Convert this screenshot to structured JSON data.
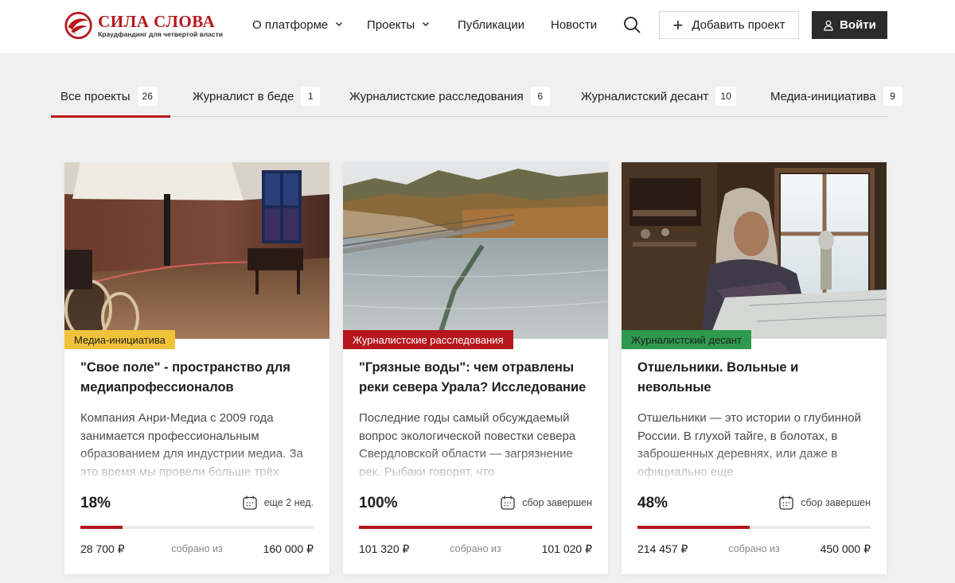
{
  "header": {
    "logo_title": "СИЛА СЛОВА",
    "logo_subtitle": "Краудфандинг для четвертой власти",
    "nav": [
      {
        "label": "О платформе",
        "has_dropdown": true
      },
      {
        "label": "Проекты",
        "has_dropdown": true
      },
      {
        "label": "Публикации",
        "has_dropdown": false
      },
      {
        "label": "Новости",
        "has_dropdown": false
      }
    ],
    "search_icon": "search-icon",
    "add_project_label": "Добавить проект",
    "login_label": "Войти"
  },
  "tabs": [
    {
      "label": "Все проекты",
      "count": "26",
      "active": true
    },
    {
      "label": "Журналист в беде",
      "count": "1",
      "active": false
    },
    {
      "label": "Журналистские расследования",
      "count": "6",
      "active": false
    },
    {
      "label": "Журналистский десант",
      "count": "10",
      "active": false
    },
    {
      "label": "Медиа-инициатива",
      "count": "9",
      "active": false
    }
  ],
  "colors": {
    "brand": "#b5171c",
    "dark_button": "#2b2b2b",
    "badge_media": "#f0c23a",
    "badge_investigation": "#b5171c",
    "badge_landing": "#2e9a4d"
  },
  "cards": [
    {
      "category": "Медиа-инициатива",
      "title": "\"Свое поле\" - пространство для медиапрофессионалов",
      "description": "Компания Анри-Медиа с 2009 года занимается профессиональным образованием для индустрии медиа. За это время мы провели больше трёх",
      "percent": "18%",
      "progress": 0.18,
      "deadline": "еще 2 нед.",
      "raised": "28 700 ₽",
      "raised_label": "собрано из",
      "goal": "160 000 ₽"
    },
    {
      "category": "Журналистские расследования",
      "title": "\"Грязные воды\": чем отравлены реки севера Урала? Исследование",
      "description": "Последние годы самый обсуждаемый вопрос экологической повестки севера Свердловской области — загрязнение рек. Рыбаки говорят, что",
      "percent": "100%",
      "progress": 1.0,
      "deadline": "сбор завершен",
      "raised": "101 320 ₽",
      "raised_label": "собрано из",
      "goal": "101 020 ₽"
    },
    {
      "category": "Журналистский десант",
      "title": "Отшельники. Вольные и невольные",
      "description": "Отшельники — это истории о глубинной России. В глухой тайге, в болотах, в заброшенных деревнях, или даже в официально еще",
      "percent": "48%",
      "progress": 0.48,
      "deadline": "сбор завершен",
      "raised": "214 457 ₽",
      "raised_label": "собрано из",
      "goal": "450 000 ₽"
    }
  ]
}
